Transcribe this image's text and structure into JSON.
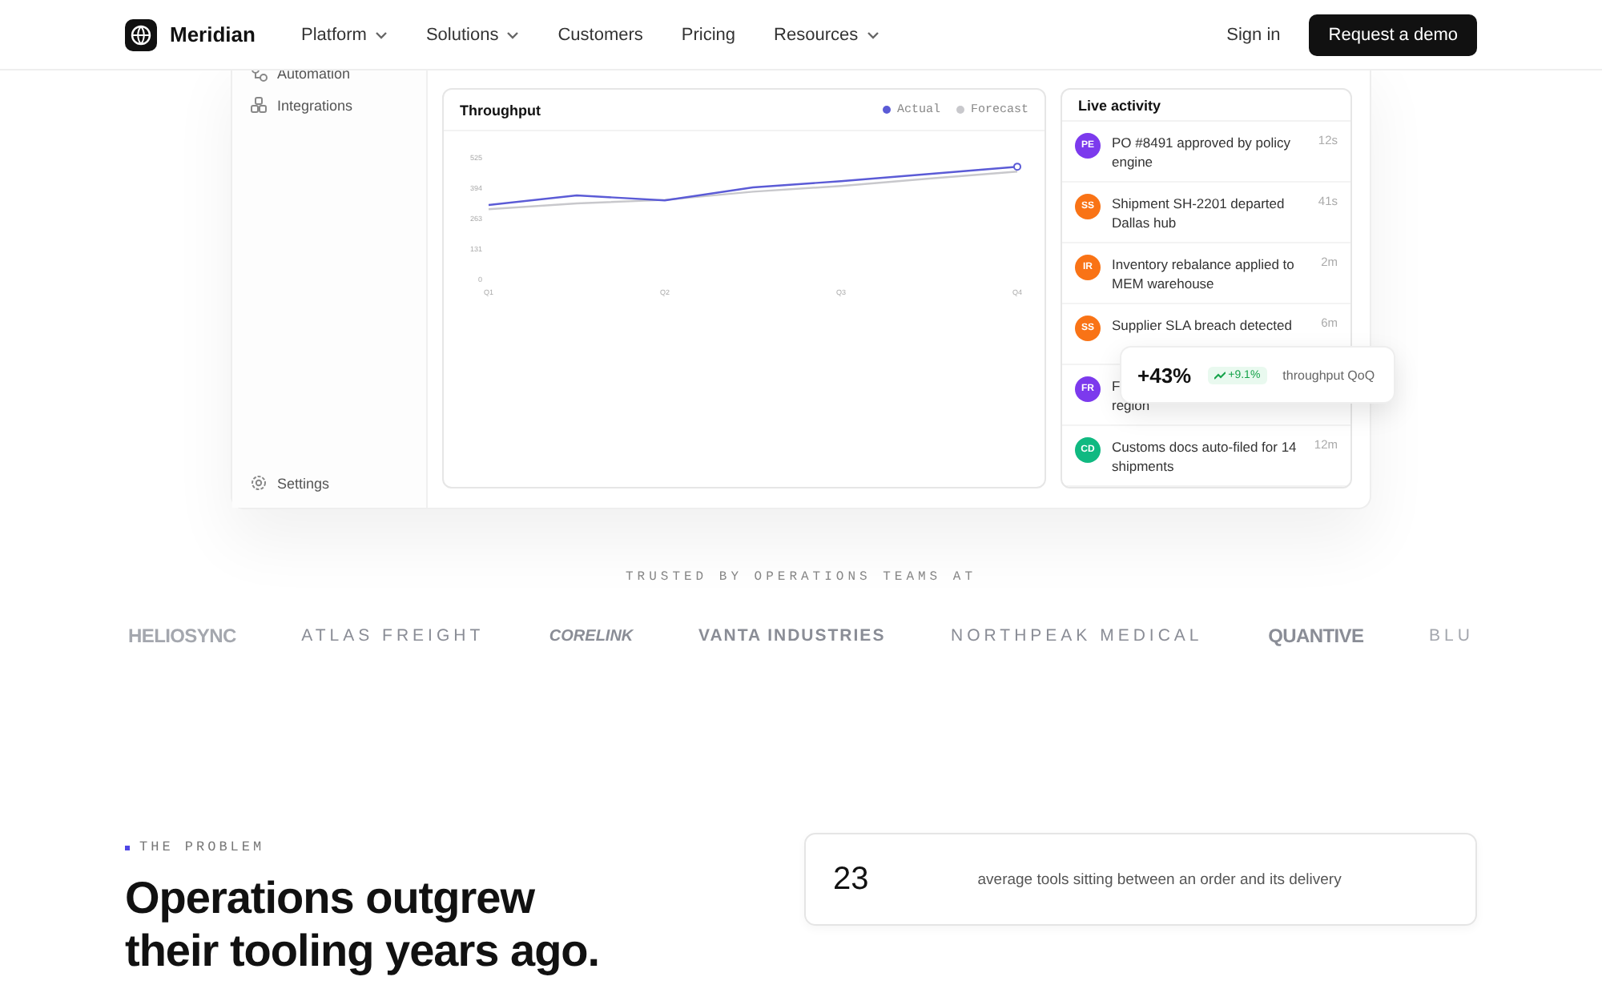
{
  "nav": {
    "brand": "Meridian",
    "links": [
      {
        "label": "Platform",
        "dropdown": true
      },
      {
        "label": "Solutions",
        "dropdown": true
      },
      {
        "label": "Customers",
        "dropdown": false
      },
      {
        "label": "Pricing",
        "dropdown": false
      },
      {
        "label": "Resources",
        "dropdown": true
      }
    ],
    "sign_in": "Sign in",
    "cta": "Request a demo"
  },
  "dashboard": {
    "sidebar": [
      {
        "kind": "automation",
        "label": "Automation"
      },
      {
        "kind": "integrations",
        "label": "Integrations"
      }
    ],
    "sidebar_footer": {
      "kind": "settings",
      "label": "Settings"
    },
    "chart": {
      "title": "Throughput",
      "chart_data": {
        "type": "line",
        "categories": [
          "Q1",
          null,
          "Q2",
          null,
          "Q3",
          null,
          "Q4"
        ],
        "ylim": [
          0,
          525
        ],
        "yticks": [
          0,
          131,
          263,
          394,
          525
        ],
        "series": [
          {
            "name": "Actual",
            "color": "#5b5bd6",
            "values": [
              318,
              359,
              338,
              394,
              421,
              452,
              483
            ]
          },
          {
            "name": "Forecast",
            "color": "#c8c8cc",
            "values": [
              300,
              325,
              340,
              375,
              400,
              432,
              462
            ]
          }
        ]
      }
    },
    "activity": {
      "title": "Live activity",
      "items": [
        {
          "initials": "PE",
          "color": "#7c3aed",
          "lines": [
            "PO #8491 approved by policy",
            "engine"
          ],
          "time": "12s"
        },
        {
          "initials": "SS",
          "color": "#f97316",
          "lines": [
            "Shipment SH-2201 departed",
            "Dallas hub"
          ],
          "time": "41s"
        },
        {
          "initials": "IR",
          "color": "#f97316",
          "lines": [
            "Inventory rebalance applied to",
            "MEM warehouse"
          ],
          "time": "2m"
        },
        {
          "initials": "SS",
          "color": "#f97316",
          "lines": [
            "Supplier SLA breach detected"
          ],
          "time": "6m"
        },
        {
          "initials": "FR",
          "color": "#7c3aed",
          "lines": [
            "F",
            "region"
          ]
        },
        {
          "initials": "CD",
          "color": "#10b981",
          "lines": [
            "Customs docs auto-filed for 14",
            "shipments"
          ],
          "time": "12m"
        }
      ]
    },
    "stat_popup": {
      "value": "+43%",
      "delta": "+9.1%",
      "label": "throughput QoQ"
    }
  },
  "logos": {
    "heading": "TRUSTED BY OPERATIONS TEAMS AT",
    "items": [
      {
        "name": "HELIOSYNC",
        "kind": "bold",
        "fade": true
      },
      {
        "name": "ATLAS FREIGHT",
        "kind": "spaced",
        "fade": false
      },
      {
        "name": "CORELINK",
        "kind": "italic",
        "fade": false
      },
      {
        "name": "VANTA INDUSTRIES",
        "kind": "wide",
        "fade": false
      },
      {
        "name": "NORTHPEAK MEDICAL",
        "kind": "spaced",
        "fade": false
      },
      {
        "name": "QUANTIVE",
        "kind": "bold",
        "fade": false
      },
      {
        "name": "BLU",
        "kind": "spaced",
        "fade": true
      }
    ]
  },
  "problem": {
    "eyebrow": "THE PROBLEM",
    "heading": "Operations outgrew their tooling years ago.",
    "stat": {
      "value": "23",
      "label": "average tools sitting between an order and its delivery"
    }
  }
}
